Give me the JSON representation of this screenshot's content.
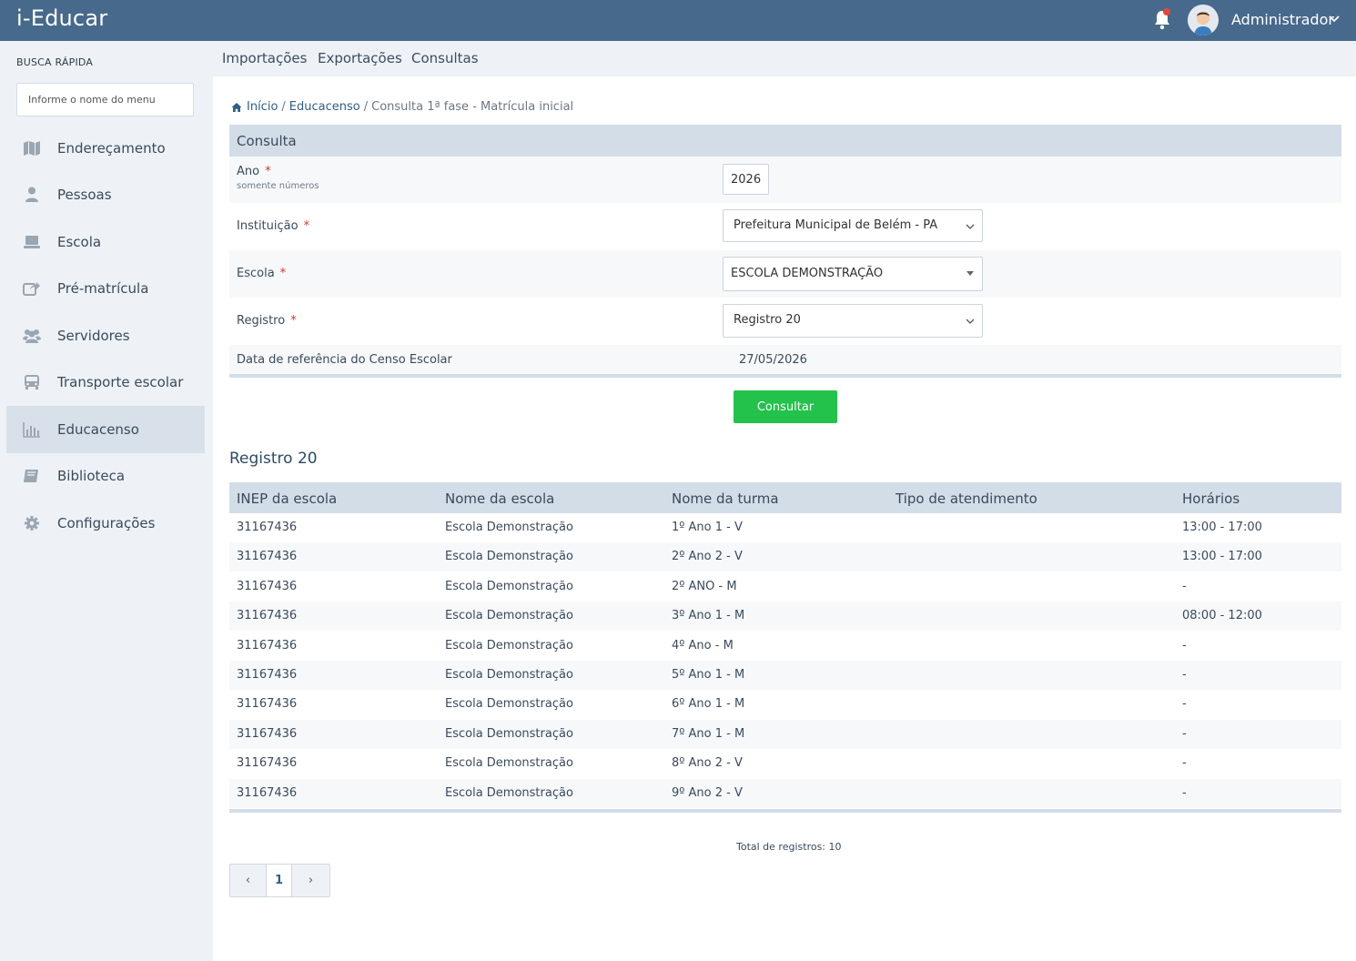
{
  "app": {
    "title": "i-Educar"
  },
  "user": {
    "name": "Administrador"
  },
  "sidebar": {
    "quick_search_label": "BUSCA RÁPIDA",
    "quick_search_placeholder": "Informe o nome do menu",
    "items": [
      {
        "label": "Endereçamento",
        "icon": "map-icon"
      },
      {
        "label": "Pessoas",
        "icon": "person-icon"
      },
      {
        "label": "Escola",
        "icon": "laptop-icon"
      },
      {
        "label": "Pré-matrícula",
        "icon": "share-icon"
      },
      {
        "label": "Servidores",
        "icon": "group-icon"
      },
      {
        "label": "Transporte escolar",
        "icon": "bus-icon"
      },
      {
        "label": "Educacenso",
        "icon": "bar-chart-icon"
      },
      {
        "label": "Biblioteca",
        "icon": "book-icon"
      },
      {
        "label": "Configurações",
        "icon": "gear-icon"
      }
    ],
    "active": "Educacenso"
  },
  "subnav": {
    "items": [
      "Importações",
      "Exportações",
      "Consultas"
    ]
  },
  "breadcrumb": {
    "home": "Início",
    "sep": "/",
    "section": "Educacenso",
    "current": "Consulta 1ª fase - Matrícula inicial"
  },
  "form": {
    "header": "Consulta",
    "ano_label": "Ano",
    "ano_hint": "somente números",
    "ano_value": "2026",
    "instituicao_label": "Instituição",
    "instituicao_value": "Prefeitura Municipal de Belém - PA",
    "escola_label": "Escola",
    "escola_value": "ESCOLA DEMONSTRAÇÃO",
    "registro_label": "Registro",
    "registro_value": "Registro 20",
    "data_ref_label": "Data de referência do Censo Escolar",
    "data_ref_value": "27/05/2026",
    "required_mark": "*",
    "submit_label": "Consultar"
  },
  "results": {
    "title": "Registro 20",
    "columns": [
      "INEP da escola",
      "Nome da escola",
      "Nome da turma",
      "Tipo de atendimento",
      "Horários"
    ],
    "rows": [
      [
        "31167436",
        "Escola Demonstração",
        "1º Ano 1 - V",
        "",
        "13:00 - 17:00"
      ],
      [
        "31167436",
        "Escola Demonstração",
        "2º Ano 2 - V",
        "",
        "13:00 - 17:00"
      ],
      [
        "31167436",
        "Escola Demonstração",
        "2º ANO - M",
        "",
        "-"
      ],
      [
        "31167436",
        "Escola Demonstração",
        "3º Ano 1 - M",
        "",
        "08:00 - 12:00"
      ],
      [
        "31167436",
        "Escola Demonstração",
        "4º Ano - M",
        "",
        "-"
      ],
      [
        "31167436",
        "Escola Demonstração",
        "5º Ano 1 - M",
        "",
        "-"
      ],
      [
        "31167436",
        "Escola Demonstração",
        "6º Ano 1 - M",
        "",
        "-"
      ],
      [
        "31167436",
        "Escola Demonstração",
        "7º Ano 1 - M",
        "",
        "-"
      ],
      [
        "31167436",
        "Escola Demonstração",
        "8º Ano 2 - V",
        "",
        "-"
      ],
      [
        "31167436",
        "Escola Demonstração",
        "9º Ano 2 - V",
        "",
        "-"
      ]
    ],
    "total_text": "Total de registros: 10"
  },
  "pagination": {
    "prev": "‹",
    "current": "1",
    "next": "›"
  },
  "colors": {
    "topbar": "#47698c",
    "accent_button": "#22c24b",
    "header_band": "#d3dde7",
    "required": "#d9342b"
  }
}
